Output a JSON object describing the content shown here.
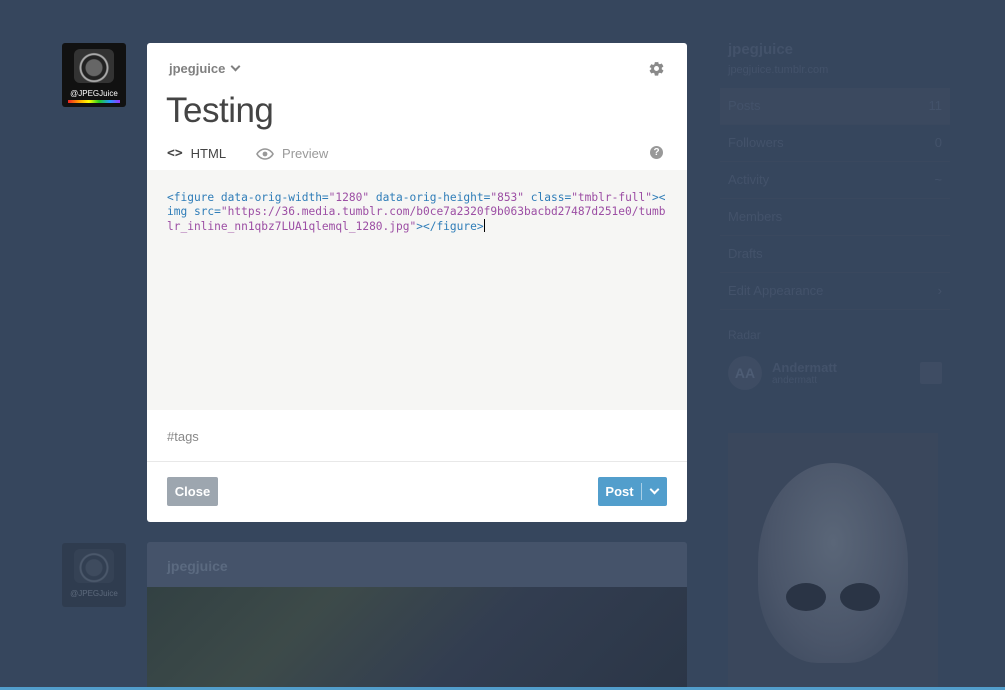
{
  "background": {
    "avatar_tag": "@JPEGJuice",
    "post_blog_name": "jpegjuice",
    "sidebar": {
      "blog_name": "jpegjuice",
      "blog_url": "jpegjuice.tumblr.com",
      "items": [
        {
          "label": "Posts",
          "count": "11"
        },
        {
          "label": "Followers",
          "count": "0"
        },
        {
          "label": "Activity",
          "count": "~"
        },
        {
          "label": "Members",
          "count": ""
        },
        {
          "label": "Drafts",
          "count": ""
        },
        {
          "label": "Edit Appearance",
          "count": "›"
        }
      ],
      "radar_label": "Radar",
      "radar_user_initials": "AA",
      "radar_user_name": "Andermatt",
      "radar_user_sub": "andermatt"
    }
  },
  "modal": {
    "blog_selector": "jpegjuice",
    "title": "Testing",
    "tabs": {
      "html": "HTML",
      "preview": "Preview"
    },
    "help_glyph": "?",
    "code": {
      "open_figure": "<figure",
      "attr1": " data-orig-width=",
      "val1": "\"1280\"",
      "attr2": " data-orig-height=",
      "val2": "\"853\"",
      "attr3": " class=",
      "val3": "\"tmblr-full\"",
      "close_bracket": ">",
      "open_img": "<img",
      "attr4": " src=",
      "val4": "\"https://36.media.tumblr.com/b0ce7a2320f9b063bacbd27487d251e0/tumblr_inline_nn1qbz7LUA1qlemql_1280.jpg\"",
      "close_img": ">",
      "close_figure": "</figure>"
    },
    "tags_placeholder": "#tags",
    "close_label": "Close",
    "post_label": "Post"
  },
  "colors": {
    "page_bg": "#36465d",
    "accent": "#529ecc",
    "close_button": "#9da6af",
    "code_tag": "#2f7db8",
    "code_value": "#9c4ea4"
  },
  "icons": [
    "camera-avatar-icon",
    "chevron-down-icon",
    "gear-icon",
    "code-icon",
    "eye-icon",
    "help-icon"
  ]
}
